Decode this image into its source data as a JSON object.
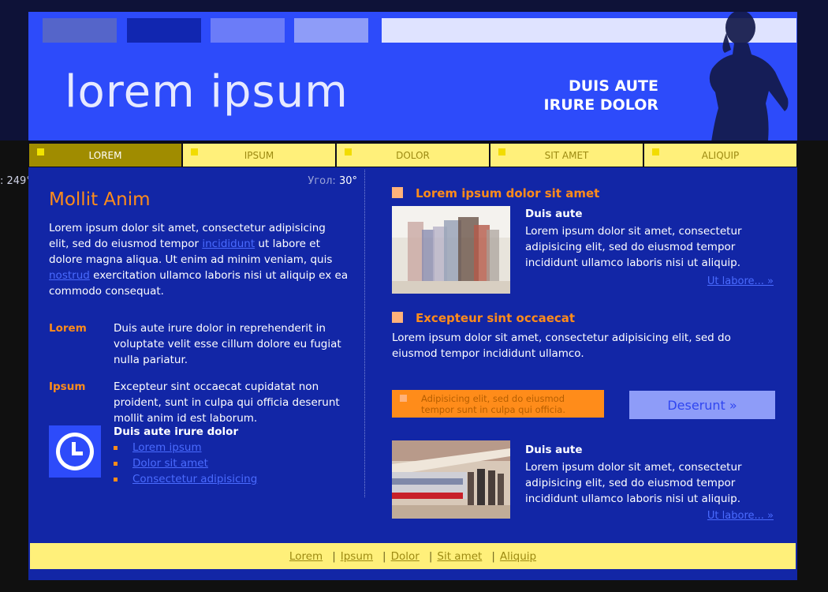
{
  "outside": {
    "angle_text": ": 249°"
  },
  "header": {
    "logo": "lorem ipsum",
    "slogan_line1": "DUIS AUTE",
    "slogan_line2": "IRURE DOLOR",
    "search_value": ""
  },
  "nav": {
    "items": [
      {
        "label": "LOREM",
        "active": true
      },
      {
        "label": "IPSUM",
        "active": false
      },
      {
        "label": "DOLOR",
        "active": false
      },
      {
        "label": "SIT AMET",
        "active": false
      },
      {
        "label": "ALIQUIP",
        "active": false
      }
    ]
  },
  "left": {
    "angle_label": "Угол:",
    "angle_value": "30°",
    "heading": "Mollit Anim",
    "intro_1": "Lorem ipsum dolor sit amet, consectetur adipisicing elit, sed do eiusmod tempor ",
    "intro_link1": "incididunt",
    "intro_2": " ut labore et dolore magna aliqua. Ut enim ad minim veniam, quis ",
    "intro_link2": "nostrud",
    "intro_3": " exercitation ullamco laboris nisi ut aliquip ex ea commodo consequat.",
    "defs": [
      {
        "term": "Lorem",
        "desc": "Duis aute irure dolor in reprehenderit in voluptate velit esse cillum dolore eu fugiat nulla pariatur."
      },
      {
        "term": "Ipsum",
        "desc": "Excepteur sint occaecat cupidatat non proident, sunt in culpa qui officia deserunt mollit anim id est laborum."
      }
    ],
    "links_title": "Duis aute irure dolor",
    "links": [
      "Lorem ipsum",
      "Dolor sit amet",
      "Consectetur adipisicing"
    ]
  },
  "right": {
    "section1_title": "Lorem ipsum dolor sit amet",
    "article1": {
      "title": "Duis aute",
      "text": "Lorem ipsum dolor sit amet, consectetur adipisicing elit, sed do eiusmod tempor incididunt ullamco laboris nisi ut aliquip.",
      "more": "Ut labore... »"
    },
    "section2_title": "Excepteur sint occaecat",
    "section2_text": "Lorem ipsum dolor sit amet, consectetur adipisicing elit, sed do eiusmod tempor incididunt ullamco.",
    "note": "Adipisicing elit, sed do eiusmod tempor sunt in culpa qui officia.",
    "button": "Deserunt »",
    "article2": {
      "title": "Duis aute",
      "text": "Lorem ipsum dolor sit amet, consectetur adipisicing elit, sed do eiusmod tempor incididunt ullamco laboris nisi ut aliquip.",
      "more": "Ut labore... »"
    }
  },
  "footer": {
    "links": [
      "Lorem",
      "Ipsum",
      "Dolor",
      "Sit amet",
      "Aliquip"
    ],
    "separator": "|"
  },
  "colors": {
    "header_blue": "#2d4bfa",
    "body_blue": "#1226a6",
    "accent_orange": "#ff8c1a",
    "nav_yellow": "#fff07a",
    "nav_active": "#a08c00"
  },
  "icons": [
    "clock-icon",
    "woman-silhouette",
    "crowd-photo",
    "train-photo"
  ]
}
